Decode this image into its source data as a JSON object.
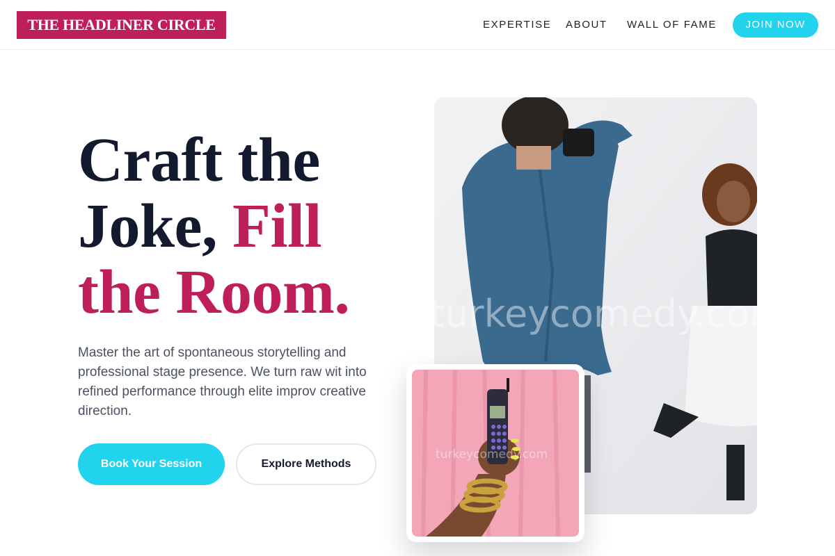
{
  "brand": {
    "name": "THE HEADLINER CIRCLE",
    "color": "#be1e5a"
  },
  "nav": {
    "links": [
      "EXPERTISE",
      "ABOUT",
      "WALL OF FAME"
    ],
    "cta": "JOIN NOW",
    "cta_color": "#22d3ee"
  },
  "hero": {
    "headline_line1": "Craft the",
    "headline_line2_dark": "Joke,",
    "headline_line2_accent": "Fill",
    "headline_line3": "the Room.",
    "description": "Master the art of spontaneous storytelling and professional stage presence. We turn raw wit into refined performance through elite improv creative direction.",
    "primary_button": "Book Your Session",
    "secondary_button": "Explore Methods"
  },
  "images": {
    "main_alt": "photographer-and-woman-photo",
    "inset_alt": "hand-holding-retro-phone-photo",
    "watermark": "turkeycomedy.com"
  }
}
